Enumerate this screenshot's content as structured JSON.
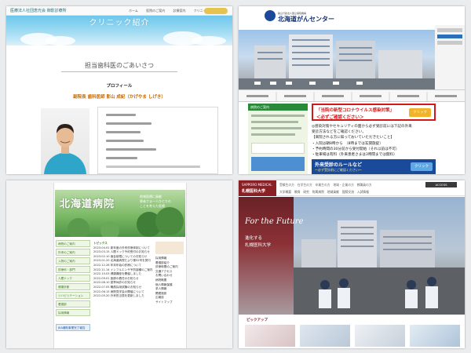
{
  "top_left": {
    "logo_text": "医療法人社団恵光会 御影診療所",
    "nav": [
      "ホーム",
      "医院のご案内",
      "診療案内",
      "クリニック紹介"
    ],
    "hero_title": "クリニック紹介",
    "section_title": "担当歯科医のごあいさつ",
    "profile_heading": "プロフィール",
    "doctor_name": "副院長 歯科医師 影山 成紀（かげやま しげき）"
  },
  "top_right": {
    "logo_small": "独立行政法人国立病院機構",
    "logo_main": "北海道がんセンター",
    "green_header": "病院のご案内",
    "notice_line1": "「当院の新型コロナウイルス感染対策」",
    "notice_line2": "＜必ずご確認ください＞",
    "notice_button": "クリック",
    "body_lines": [
      "◎感染対策やセキュリティの面から必ず受診前には下記の外来",
      "受診方法などをご確認ください。",
      "【来院される方に知っておいていただきたいこと】",
      "・入院は朝8時から　（8時までは玄関施錠）",
      "・予約時間の30分前から受付開始（それ以前は不可）",
      "・駐車場は有料（外来患者さまは3時間までは無料）"
    ],
    "rule_title": "外来受診のルールなど",
    "rule_sub": "〜必ず受診前にご確認ください〜",
    "rule_button": "クリック"
  },
  "bottom_left": {
    "banner_title": "北海道病院",
    "banner_lines": [
      "地域医療に貢献",
      "患者さま一人ひとりの",
      "ことを考えた医療"
    ],
    "left_nav": [
      "病院のご案内",
      "外来のご案内",
      "入院のご案内",
      "診療科・部門",
      "人間ドック",
      "健康診断",
      "リハビリテーション",
      "看護部",
      "採用情報",
      "お知らせ"
    ],
    "jka_label": "JKA補助事業完了報告",
    "news_heading": "トピックス",
    "news": [
      "2023.04.01 新年度の外来診療体制について",
      "2023.03.15 人間ドック予約受付のお知らせ",
      "2023.02.10 面会制限についてのお知らせ",
      "2023.01.20 北海道病院だより第52号を発行",
      "2022.12.28 年末年始の診療について",
      "2022.11.14 インフルエンザ予防接種のご案内",
      "2022.10.03 健康講座を開催しました",
      "2022.09.01 医師の着任のお知らせ",
      "2022.08.10 夏季休診のお知らせ",
      "2022.07.05 職員採用試験のお知らせ",
      "2022.06.15 病院見学会の開催について",
      "2022.05.20 外来担当表を更新しました"
    ],
    "right_links": [
      "採用情報",
      "看護部紹介",
      "診療時間のご案内",
      "交通アクセス",
      "お問い合わせ",
      "病院概要",
      "個人情報保護",
      "求人情報",
      "関連施設",
      "広報誌",
      "サイトマップ"
    ]
  },
  "bottom_right": {
    "emblem_small": "SAPPORO MEDICAL",
    "emblem_main": "札幌医科大学",
    "top_nav": "受験生の方　在学生の方　卒業生の方　地域・企業の方　教職員の方",
    "sub_nav": "大学概要　教育　研究　附属病院　地域貢献　国際交流　入試情報",
    "access_label": "ACCESS",
    "hero_en": "For the Future",
    "hero_jp1": "進化する",
    "hero_jp2": "札幌医科大学",
    "pickup_label": "ピックアップ"
  }
}
